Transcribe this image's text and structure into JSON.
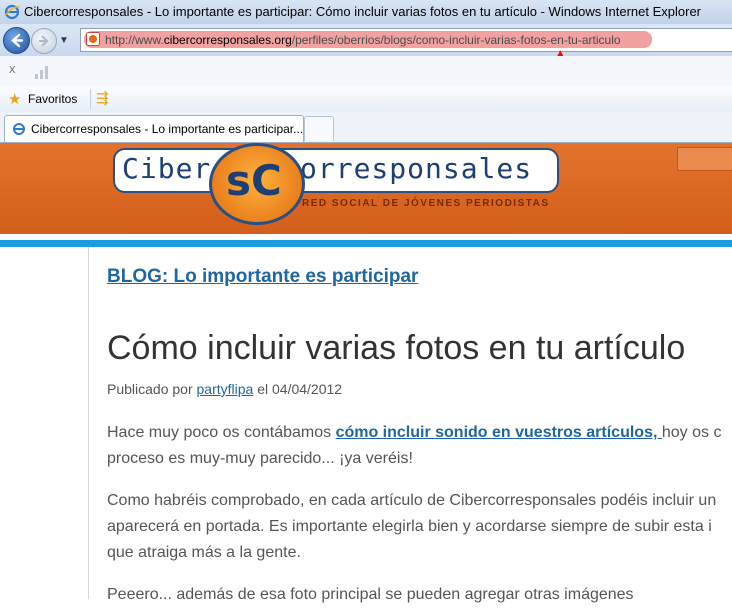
{
  "window": {
    "title": "Cibercorresponsales - Lo importante es participar: Cómo incluir varias fotos en tu artículo - Windows Internet Explorer"
  },
  "address_bar": {
    "url_prefix": "http://www.",
    "url_domain": "cibercorresponsales.org",
    "url_path": "/perfiles/oberrios/blogs/como-incluir-varias-fotos-en-tu-articulo"
  },
  "toolbar": {
    "stop_glyph": "x",
    "favorites_label": "Favoritos"
  },
  "tabs": [
    {
      "label": "Cibercorresponsales - Lo importante es participar..."
    }
  ],
  "logo": {
    "left_text": "Ciber",
    "circle_text": "sC",
    "right_text": "orresponsales",
    "tagline": "RED SOCIAL DE JÓVENES PERIODISTAS"
  },
  "article": {
    "blog_link": "BLOG: Lo importante es participar",
    "title": "Cómo incluir varias fotos en tu artículo",
    "meta_prefix": "Publicado por ",
    "meta_author": "partyflipa",
    "meta_suffix": " el 04/04/2012",
    "p1_line1_pre": "Hace muy poco os contábamos ",
    "p1_line1_link": "cómo incluir sonido en vuestros artículos, ",
    "p1_line1_post": "hoy os c",
    "p1_line2": "proceso es muy-muy parecido... ¡ya veréis!",
    "p2_line1": "Como habréis comprobado, en cada artículo de Cibercorresponsales podéis incluir un",
    "p2_line2": "aparecerá en portada. Es importante elegirla bien y acordarse siempre de subir esta i",
    "p2_line3": "que atraiga más a la gente.",
    "p3_line1": "Peeero... además de esa foto principal se pueden agregar otras imágenes"
  },
  "colors": {
    "header_orange": "#d9651f",
    "accent_blue": "#1e9be0",
    "link_blue": "#1f67a3",
    "annotation_red": "#ff0000"
  }
}
